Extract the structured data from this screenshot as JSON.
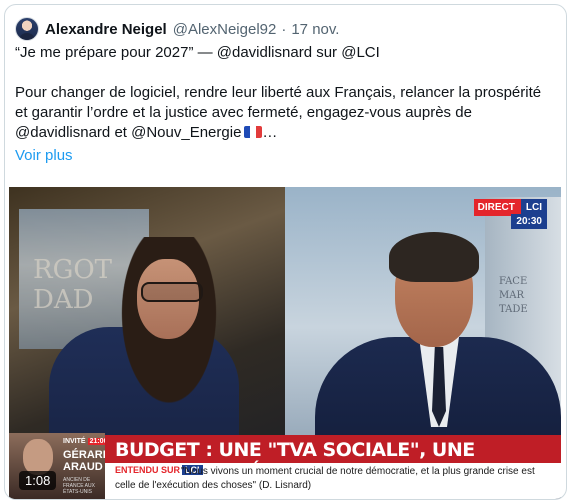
{
  "tweet": {
    "author_name": "Alexandre Neigel",
    "handle": "@AlexNeigel92",
    "separator": "·",
    "date": "17 nov.",
    "line1": "“Je me prépare pour 2027” — @davidlisnard sur @LCI",
    "body": "Pour changer de logiciel, rendre leur liberté aux Français, relancer la prospérité et garantir l’ordre et la justice avec fermeté, engagez-vous auprès de @davidlisnard et @Nouv_Energie",
    "body_suffix": "…",
    "flag_icon": "french-flag-emoji",
    "show_more": "Voir plus"
  },
  "video": {
    "live_label": "DIRECT",
    "channel": "LCI",
    "clock": "20:30",
    "duration": "1:08",
    "guest_tag": "INVITÉ",
    "guest_time": "21:00",
    "guest_name_line1": "GÉRARD",
    "guest_name_line2": "ARAUD",
    "guest_subtitle": "ANCIEN DE FRANCE AUX ÉTATS-UNIS",
    "headline": "BUDGET : UNE \"TVA SOCIALE\", UNE MAUVAISE IDÉE ?",
    "quote_tag": "ENTENDU SUR",
    "quote_channel": "LCI",
    "quote": "\"Nous vivons un moment crucial de notre démocratie, et la plus grande crise est celle de l'exécution des choses\" (D. Lisnard)",
    "backdrop_left_words": "RGOT\nDAD",
    "backdrop_right_words": "FACE\nMAR\nTADE"
  },
  "colors": {
    "link": "#1d9bf0",
    "text": "#0f1419",
    "muted": "#536471",
    "lci_red": "#bf1e26",
    "lci_blue": "#1c3f8f"
  }
}
